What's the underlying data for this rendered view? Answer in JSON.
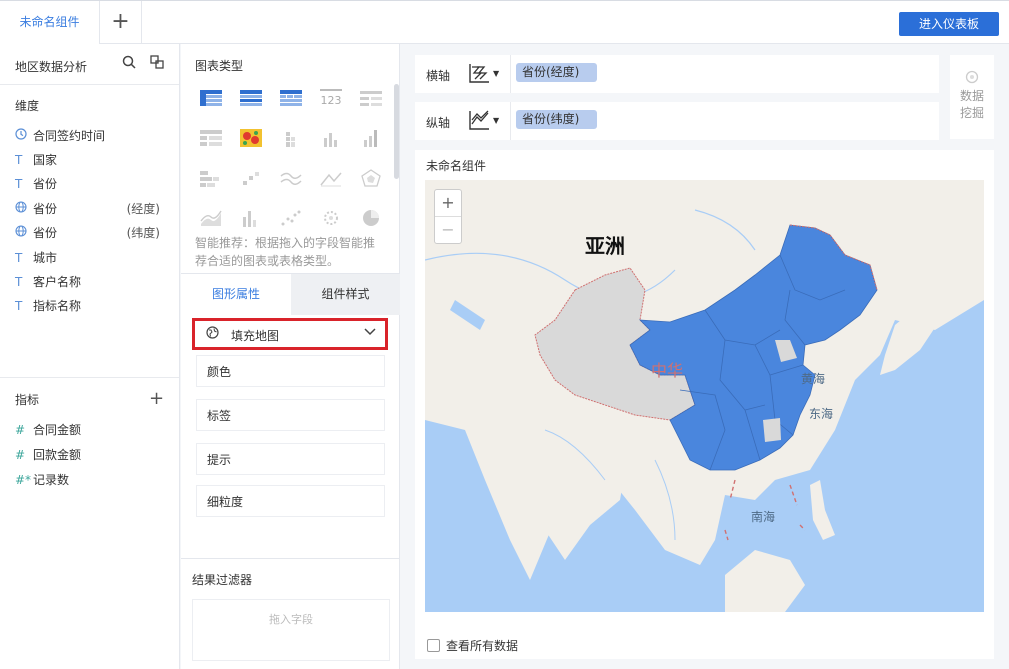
{
  "header": {
    "tab_label": "未命名组件",
    "add_tab_symbol": "+",
    "enter_dashboard_label": "进入仪表板"
  },
  "left_panel": {
    "dataset_title": "地区数据分析",
    "dimensions_title": "维度",
    "dimensions": [
      {
        "icon": "clock-icon",
        "label": "合同签约时间",
        "suffix": ""
      },
      {
        "icon": "text-icon",
        "label": "国家",
        "suffix": ""
      },
      {
        "icon": "text-icon",
        "label": "省份",
        "suffix": ""
      },
      {
        "icon": "globe-icon",
        "label": "省份",
        "suffix": "(经度)"
      },
      {
        "icon": "globe-icon",
        "label": "省份",
        "suffix": "(纬度)"
      },
      {
        "icon": "text-icon",
        "label": "城市",
        "suffix": ""
      },
      {
        "icon": "text-icon",
        "label": "客户名称",
        "suffix": ""
      },
      {
        "icon": "text-icon",
        "label": "指标名称",
        "suffix": ""
      }
    ],
    "metrics_title": "指标",
    "metrics": [
      {
        "icon": "hash-icon",
        "label": "合同金额"
      },
      {
        "icon": "hash-icon",
        "label": "回款金额"
      },
      {
        "icon": "hash-star-icon",
        "label": "记录数"
      }
    ]
  },
  "middle_panel": {
    "chart_type_title": "图表类型",
    "smart_hint": "智能推荐：根据拖入的字段智能推荐合适的图表或表格类型。",
    "tab_graphic": "图形属性",
    "tab_component": "组件样式",
    "map_type": "填充地图",
    "properties": [
      "颜色",
      "标签",
      "提示",
      "细粒度"
    ],
    "filter_title": "结果过滤器",
    "filter_placeholder": "拖入字段"
  },
  "axes": {
    "x_label": "横轴",
    "x_field": "省份(经度)",
    "y_label": "纵轴",
    "y_field": "省份(纬度)"
  },
  "data_mining": {
    "line1": "数据",
    "line2": "挖掘"
  },
  "chart": {
    "title": "未命名组件",
    "zoom_in": "+",
    "zoom_out": "−",
    "map_labels": {
      "asia": "亚洲",
      "china": "中华",
      "yellow_sea": "黄海",
      "east_sea": "东海",
      "south_sea": "南海"
    },
    "view_all_label": "查看所有数据",
    "colors": {
      "filled": "#4a86dd",
      "land": "#f2efe9",
      "sea": "#a9cdf6",
      "unfilled": "#d9d9d9"
    }
  }
}
